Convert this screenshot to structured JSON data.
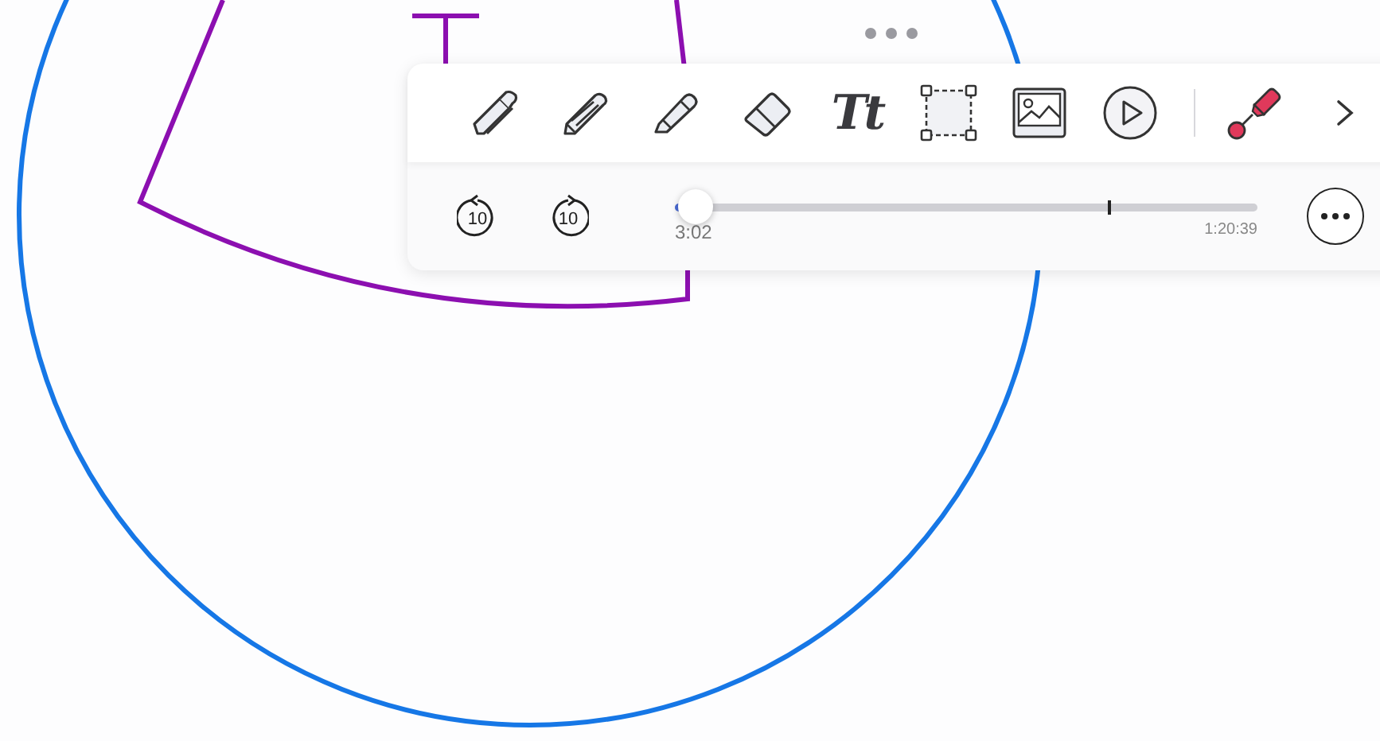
{
  "canvas": {
    "strokes": [
      {
        "kind": "circle",
        "color": "#1677e6"
      },
      {
        "kind": "sector",
        "color": "#8c0fb0"
      },
      {
        "kind": "tee",
        "color": "#8c0fb0"
      }
    ]
  },
  "toolbar": {
    "tools": [
      {
        "kind": "pen"
      },
      {
        "kind": "pencil"
      },
      {
        "kind": "highlighter"
      },
      {
        "kind": "eraser"
      },
      {
        "kind": "text",
        "label": "Tt"
      },
      {
        "kind": "selection"
      },
      {
        "kind": "image"
      },
      {
        "kind": "play"
      },
      {
        "kind": "divider"
      },
      {
        "kind": "color-pen",
        "color": "#e0395b"
      },
      {
        "kind": "next"
      }
    ],
    "playback": {
      "skip_back": "10",
      "skip_forward": "10",
      "level": 0.035,
      "marker": {
        "level": 0.745
      },
      "elapsed": "3:02",
      "total": "1:20:39"
    }
  }
}
